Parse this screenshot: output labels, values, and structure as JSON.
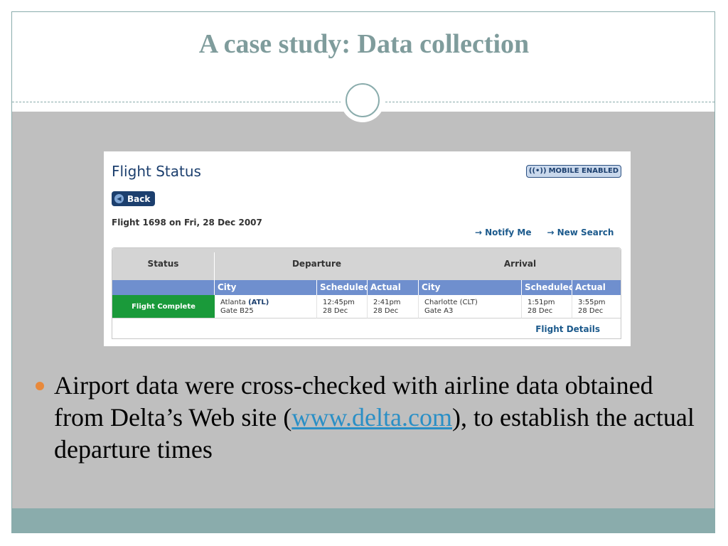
{
  "slide": {
    "title": "A case study: Data collection",
    "bullet": {
      "before": "Airport data were cross-checked with airline data obtained from Delta’s Web site (",
      "link": "www.delta.com",
      "after": "), to establish the actual departure times"
    }
  },
  "flight_status": {
    "title": "Flight Status",
    "mobile_badge": "MOBILE ENABLED",
    "back_label": "Back",
    "flight_line": "Flight 1698 on Fri, 28 Dec 2007",
    "notify_label": "Notify Me",
    "new_search_label": "New Search",
    "headers": {
      "status": "Status",
      "departure": "Departure",
      "arrival": "Arrival"
    },
    "columns": [
      "City",
      "Scheduled",
      "Actual",
      "City",
      "Scheduled",
      "Actual"
    ],
    "row": {
      "status": "Flight Complete",
      "dep_city": "Atlanta",
      "dep_code": "(ATL)",
      "dep_gate": "Gate B25",
      "dep_sched_time": "12:45pm",
      "dep_sched_date": "28 Dec",
      "dep_actual_time": "2:41pm",
      "dep_actual_date": "28 Dec",
      "arr_city": "Charlotte (CLT)",
      "arr_gate": "Gate A3",
      "arr_sched_time": "1:51pm",
      "arr_sched_date": "28 Dec",
      "arr_actual_time": "3:55pm",
      "arr_actual_date": "28 Dec"
    },
    "details_label": "Flight Details"
  },
  "colors": {
    "accent_teal": "#8aacac",
    "status_green": "#1a9a3a",
    "header_blue": "#6f8fce",
    "bullet_orange": "#e8893b",
    "link_blue": "#2a8fc6"
  }
}
